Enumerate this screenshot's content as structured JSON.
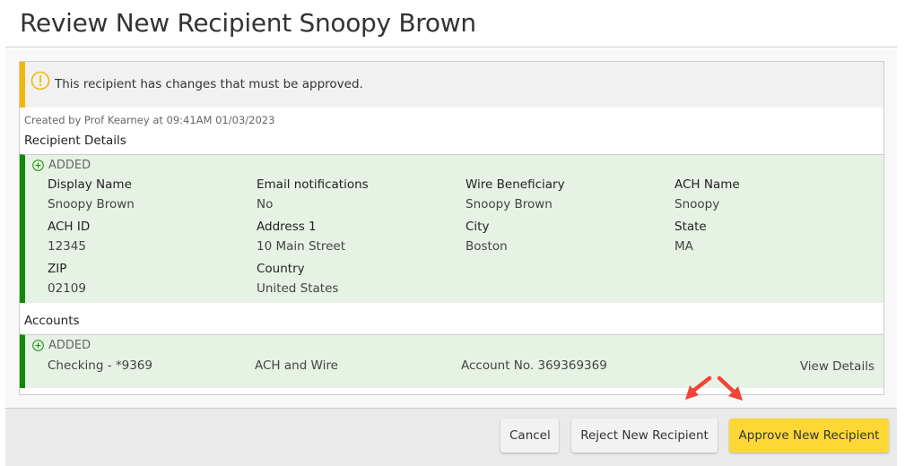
{
  "page": {
    "title": "Review New Recipient Snoopy Brown"
  },
  "alert": {
    "icon": "exclamation-circle-icon",
    "text": "This recipient has changes that must be approved.",
    "accent_color": "#f2b705"
  },
  "created_by": "Created by Prof Kearney at 09:41AM 01/03/2023",
  "recipient_details": {
    "title": "Recipient Details",
    "change_label": "ADDED",
    "change_icon": "plus-circle-icon",
    "change_color": "#108a00",
    "fields": [
      {
        "label": "Display Name",
        "value": "Snoopy Brown"
      },
      {
        "label": "Email notifications",
        "value": "No"
      },
      {
        "label": "Wire Beneficiary",
        "value": "Snoopy Brown"
      },
      {
        "label": "ACH Name",
        "value": "Snoopy"
      },
      {
        "label": "ACH ID",
        "value": "12345"
      },
      {
        "label": "Address 1",
        "value": "10 Main Street"
      },
      {
        "label": "City",
        "value": "Boston"
      },
      {
        "label": "State",
        "value": "MA"
      },
      {
        "label": "ZIP",
        "value": "02109"
      },
      {
        "label": "Country",
        "value": "United States"
      }
    ]
  },
  "accounts": {
    "title": "Accounts",
    "change_label": "ADDED",
    "items": [
      {
        "name": "Checking - *9369",
        "type": "ACH and Wire",
        "account_no": "Account No. 369369369",
        "link": "View Details"
      }
    ]
  },
  "footer": {
    "cancel_label": "Cancel",
    "reject_label": "Reject New Recipient",
    "approve_label": "Approve New Recipient",
    "approve_color": "#fdd835"
  },
  "annotation": {
    "icon": "red-arrows-icon",
    "color": "#f44336"
  }
}
